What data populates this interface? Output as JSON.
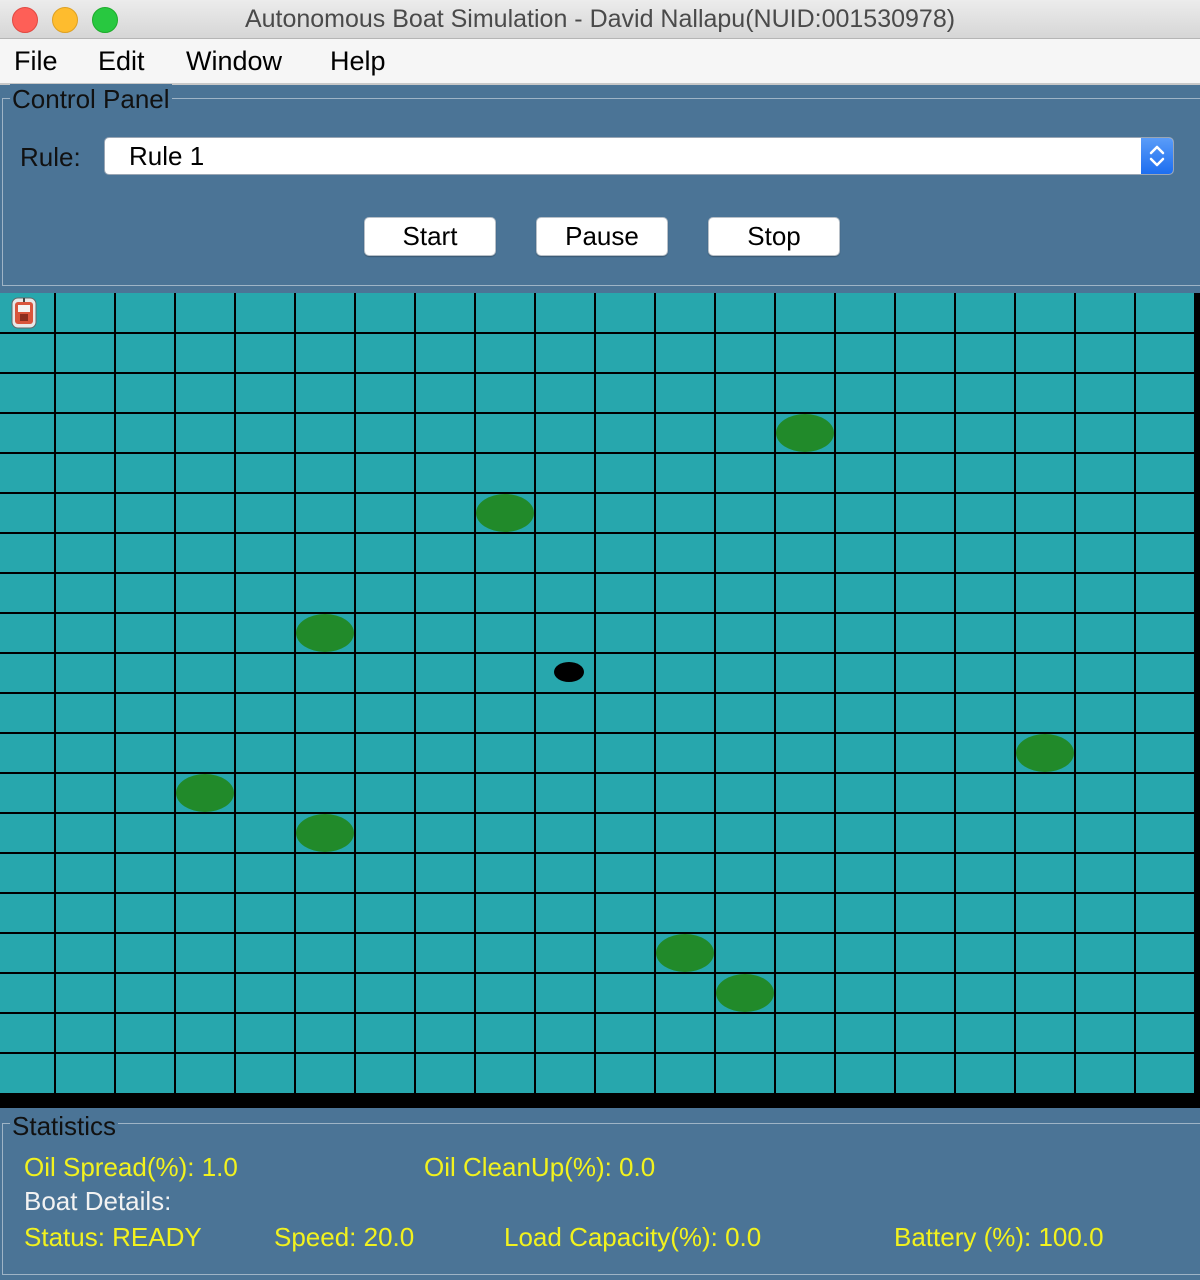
{
  "window": {
    "title": "Autonomous Boat Simulation - David Nallapu(NUID:001530978)"
  },
  "menu": [
    "File",
    "Edit",
    "Window",
    "Help"
  ],
  "control_panel": {
    "legend": "Control Panel",
    "rule_label": "Rule:",
    "rule_value": "Rule 1",
    "buttons": {
      "start": "Start",
      "pause": "Pause",
      "stop": "Stop"
    }
  },
  "grid": {
    "columns": 20,
    "rows": 20,
    "water_color": "#27a7ad",
    "line_color": "#000000",
    "oil_spills": [
      {
        "col": 13,
        "row": 3
      },
      {
        "col": 8,
        "row": 5
      },
      {
        "col": 5,
        "row": 8
      },
      {
        "col": 17,
        "row": 11
      },
      {
        "col": 3,
        "row": 12
      },
      {
        "col": 5,
        "row": 13
      },
      {
        "col": 11,
        "row": 16
      },
      {
        "col": 12,
        "row": 17
      }
    ],
    "oil_spill_color": "#218a2a",
    "black_marker": {
      "col": 9,
      "row": 9
    },
    "boat": {
      "col": 0,
      "row": 0,
      "icon": "boat-icon"
    }
  },
  "statistics": {
    "legend": "Statistics",
    "oil_spread": "Oil Spread(%): 1.0",
    "oil_cleanup": "Oil CleanUp(%): 0.0",
    "boat_details": "Boat Details:",
    "status": "Status: READY",
    "speed": "Speed: 20.0",
    "load_capacity": "Load Capacity(%): 0.0",
    "battery": "Battery (%): 100.0"
  },
  "colors": {
    "panel_bg": "#4b7496",
    "stat_text": "#f2f21e"
  }
}
